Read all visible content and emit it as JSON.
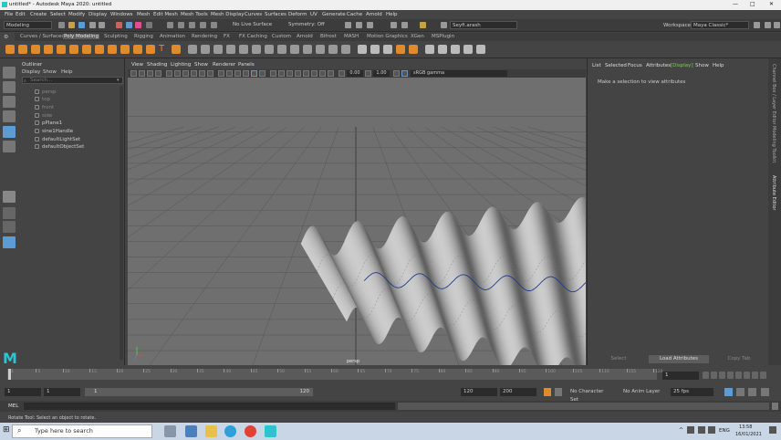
{
  "titlebar": {
    "title": "untitled* - Autodesk Maya 2020: untitled"
  },
  "menubar": {
    "items": [
      "File",
      "Edit",
      "Create",
      "Select",
      "Modify",
      "Display",
      "Windows",
      "Mesh",
      "Edit Mesh",
      "Mesh Tools",
      "Mesh Display",
      "Curves",
      "Surfaces",
      "Deform",
      "UV",
      "Generate",
      "Cache",
      "Arnold",
      "Help"
    ]
  },
  "statusline": {
    "menuset": "Modeling",
    "live_surface": "No Live Surface",
    "symmetry": "Symmetry: Off",
    "user": "Seyfi.arash",
    "workspace_label": "Workspace :",
    "workspace": "Maya Classic*"
  },
  "shelf": {
    "tabs": [
      "Curves / Surfaces",
      "Poly Modeling",
      "Sculpting",
      "Rigging",
      "Animation",
      "Rendering",
      "FX",
      "FX Caching",
      "Custom",
      "Arnold",
      "Bifrost",
      "MASH",
      "Motion Graphics",
      "XGen",
      "MSPlugin"
    ],
    "active_tab": "Poly Modeling"
  },
  "outliner": {
    "title": "Outliner",
    "menu": [
      "Display",
      "Show",
      "Help"
    ],
    "search_placeholder": "Search...",
    "items": [
      {
        "label": "persp",
        "hidden": true
      },
      {
        "label": "top",
        "hidden": true
      },
      {
        "label": "front",
        "hidden": true
      },
      {
        "label": "side",
        "hidden": true
      },
      {
        "label": "pPlane1",
        "hidden": false
      },
      {
        "label": "sine1Handle",
        "hidden": false
      },
      {
        "label": "defaultLightSet",
        "hidden": false
      },
      {
        "label": "defaultObjectSet",
        "hidden": false
      }
    ]
  },
  "viewport": {
    "menu": [
      "View",
      "Shading",
      "Lighting",
      "Show",
      "Renderer",
      "Panels"
    ],
    "exposure": "0.00",
    "gamma": "1.00",
    "colorspace": "sRGB gamma",
    "camera": "persp"
  },
  "attribute_editor": {
    "menu": [
      "List",
      "Selected",
      "Focus",
      "Attributes",
      "Display",
      "Show",
      "Help"
    ],
    "active_menu": "Display",
    "message": "Make a selection to view attributes",
    "buttons": [
      "Select",
      "Load Attributes",
      "Copy Tab"
    ],
    "side_tabs": [
      "Channel Box / Layer Editor",
      "Modeling Toolkit",
      "Attribute Editor"
    ]
  },
  "timeslider": {
    "ticks": [
      "1",
      "5",
      "10",
      "15",
      "20",
      "25",
      "30",
      "35",
      "40",
      "45",
      "50",
      "55",
      "60",
      "65",
      "70",
      "75",
      "80",
      "85",
      "90",
      "95",
      "100",
      "105",
      "110",
      "115",
      "120"
    ],
    "current_frame": "1"
  },
  "range": {
    "start": "1",
    "playback_start": "1",
    "slider_start": "1",
    "slider_end": "120",
    "playback_end": "120",
    "end": "200",
    "character_set": "No Character Set",
    "anim_layer": "No Anim Layer",
    "fps": "25 fps"
  },
  "mel": {
    "label": "MEL"
  },
  "helpline": {
    "text": "Rotate Tool: Select an object to rotate."
  },
  "taskbar": {
    "search_placeholder": "Type here to search",
    "lang": "ENG",
    "time": "13:58",
    "date": "16/01/2021"
  },
  "colors": {
    "maya_logo": "#2ec3d2",
    "accent_active": "#5d9bd5",
    "plane": "#9a9a9a"
  }
}
